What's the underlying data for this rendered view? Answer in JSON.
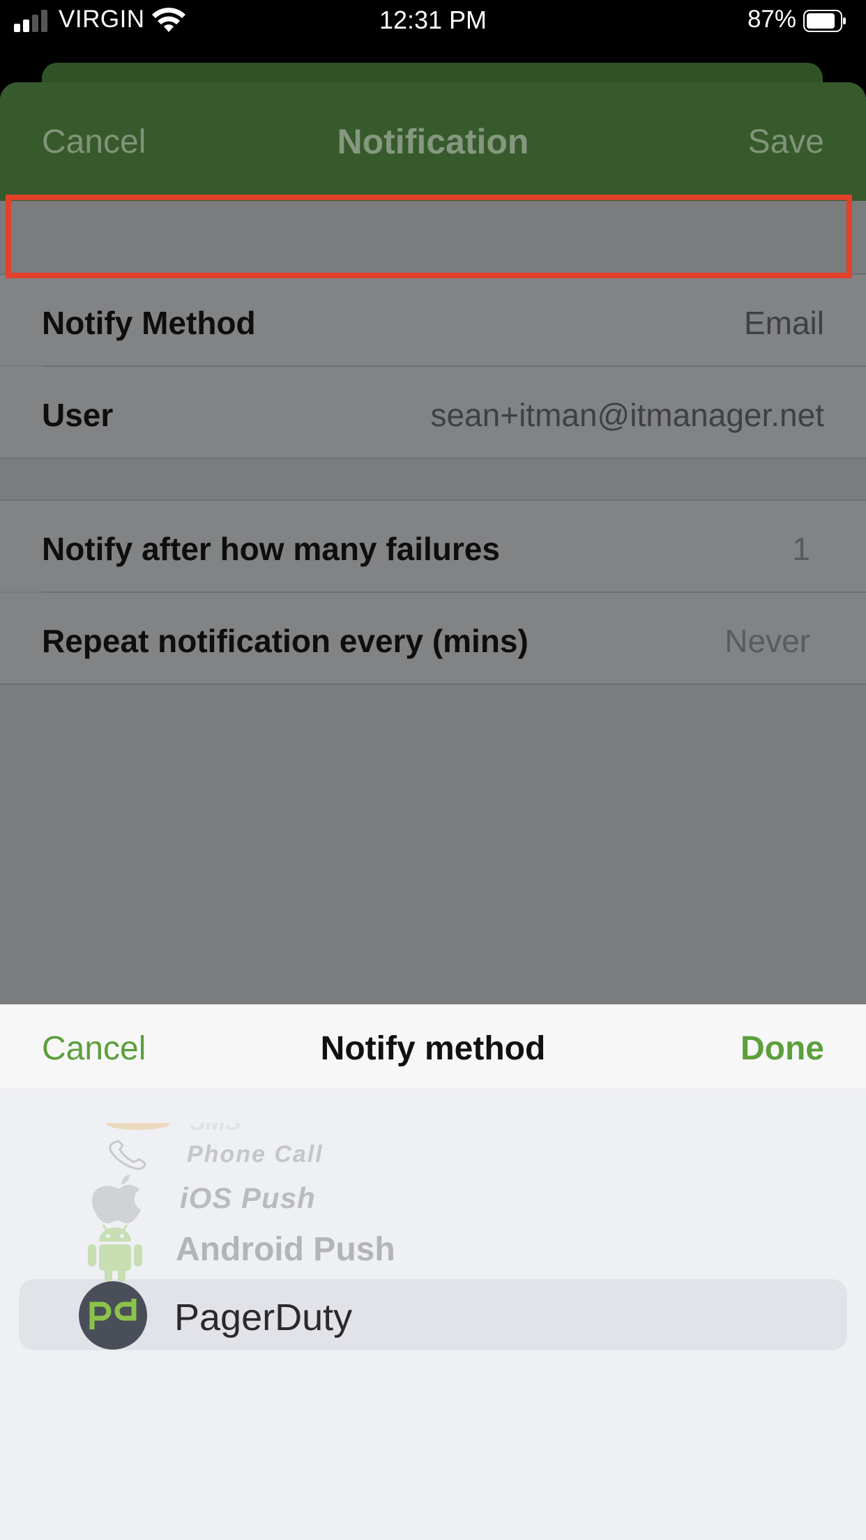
{
  "status_bar": {
    "carrier": "VIRGIN",
    "time": "12:31 PM",
    "battery": "87%",
    "battery_level": 0.87
  },
  "navbar": {
    "cancel": "Cancel",
    "title": "Notification",
    "save": "Save",
    "color": "#375a2d"
  },
  "form": {
    "notify_method": {
      "label": "Notify Method",
      "value": "Email"
    },
    "user": {
      "label": "User",
      "value": "sean+itman@itmanager.net"
    },
    "failures": {
      "label": "Notify after how many failures",
      "value": "1"
    },
    "repeat": {
      "label": "Repeat notification every (mins)",
      "value": "Never"
    }
  },
  "picker": {
    "cancel": "Cancel",
    "title": "Notify method",
    "done": "Done",
    "accent": "#5c9f3d",
    "options": [
      {
        "label": "SMS",
        "icon": "sms-icon"
      },
      {
        "label": "Phone Call",
        "icon": "phone-icon"
      },
      {
        "label": "iOS Push",
        "icon": "apple-icon"
      },
      {
        "label": "Android Push",
        "icon": "android-icon"
      },
      {
        "label": "PagerDuty",
        "icon": "pagerduty-icon",
        "selected": true
      }
    ]
  }
}
